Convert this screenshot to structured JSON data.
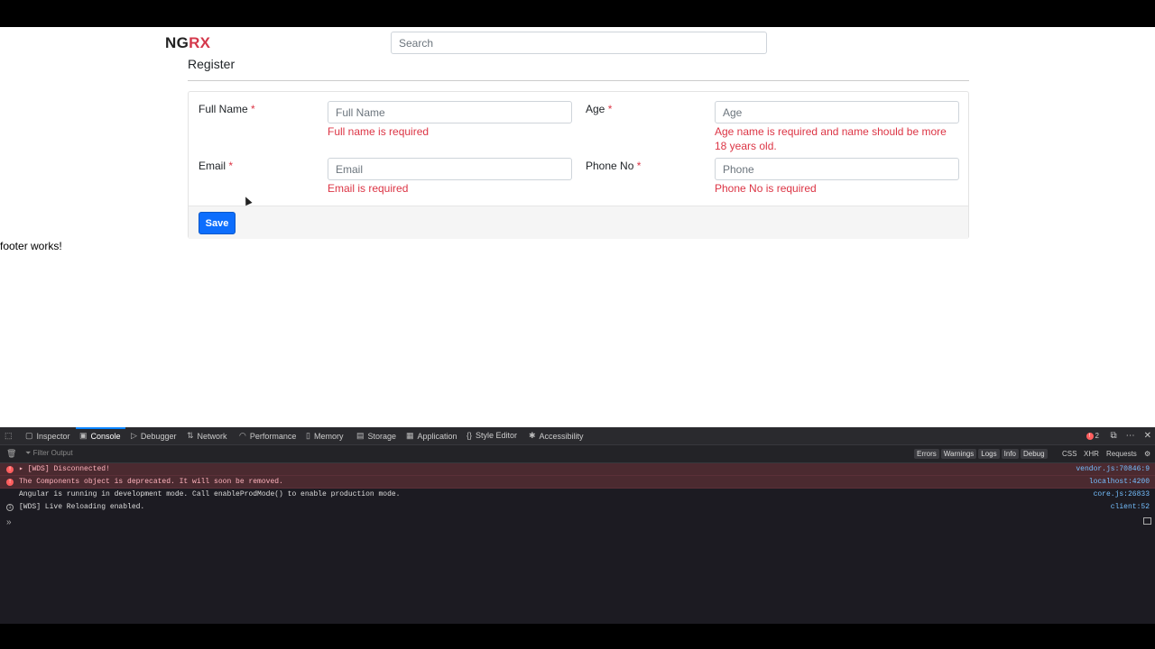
{
  "brand": {
    "part1": "NG",
    "part2": "RX"
  },
  "search": {
    "placeholder": "Search"
  },
  "form": {
    "title": "Register",
    "required_mark": "*",
    "fields": [
      {
        "label": "Full Name",
        "placeholder": "Full Name",
        "error": "Full name is required"
      },
      {
        "label": "Age",
        "placeholder": "Age",
        "error": "Age name is required and name should be more 18 years old."
      },
      {
        "label": "Email",
        "placeholder": "Email",
        "error": "Email is required"
      },
      {
        "label": "Phone No",
        "placeholder": "Phone",
        "error": "Phone No is required"
      }
    ],
    "save_label": "Save"
  },
  "footer": {
    "text": "footer works!"
  },
  "devtools": {
    "tabs": [
      {
        "label": "Inspector",
        "icon": "inspector-icon"
      },
      {
        "label": "Console",
        "icon": "console-icon"
      },
      {
        "label": "Debugger",
        "icon": "debugger-icon"
      },
      {
        "label": "Network",
        "icon": "network-icon"
      },
      {
        "label": "Performance",
        "icon": "performance-icon"
      },
      {
        "label": "Memory",
        "icon": "memory-icon"
      },
      {
        "label": "Storage",
        "icon": "storage-icon"
      },
      {
        "label": "Application",
        "icon": "application-icon"
      },
      {
        "label": "Style Editor",
        "icon": "style-editor-icon"
      },
      {
        "label": "Accessibility",
        "icon": "accessibility-icon"
      }
    ],
    "active_tab": "Console",
    "error_count": "2",
    "filter_placeholder": "Filter Output",
    "filter_buttons": [
      "Errors",
      "Warnings",
      "Logs",
      "Info",
      "Debug"
    ],
    "extra_filters": [
      "CSS",
      "XHR",
      "Requests"
    ],
    "logs": [
      {
        "type": "error",
        "message": "[WDS] Disconnected!",
        "source": "vendor.js:70846:9"
      },
      {
        "type": "error",
        "message": "The Components object is deprecated. It will soon be removed.",
        "source": "localhost:4200"
      },
      {
        "type": "log",
        "message": "Angular is running in development mode. Call enableProdMode() to enable production mode.",
        "source": "core.js:26833"
      },
      {
        "type": "info",
        "message": "[WDS] Live Reloading enabled.",
        "source": "client:52"
      }
    ],
    "prompt": "»"
  },
  "colors": {
    "accent": "#0d6efd",
    "error": "#dc3545",
    "brand_rx": "#d4384b"
  }
}
